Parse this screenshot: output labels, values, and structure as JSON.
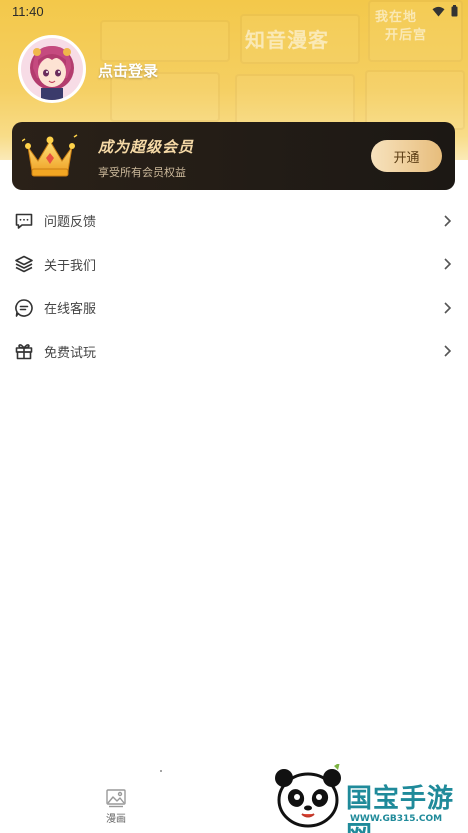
{
  "status_bar": {
    "time": "11:40",
    "wifi_icon": "wifi-icon",
    "battery_icon": "battery-icon"
  },
  "header": {
    "background_texts": [
      "知音漫客",
      "我在地",
      "开后宫"
    ],
    "login_label": "点击登录",
    "colors": {
      "header_yellow": "#f3c84a"
    }
  },
  "vip_banner": {
    "title": "成为超级会员",
    "subtitle": "享受所有会员权益",
    "button_label": "开通",
    "icon": "crown-icon",
    "colors": {
      "background": "#1f1a15",
      "title": "#f5d9a6",
      "button_gradient_start": "#f7e2bd",
      "button_gradient_end": "#e7bd7c"
    }
  },
  "menu": {
    "items": [
      {
        "label": "问题反馈",
        "icon": "feedback-icon"
      },
      {
        "label": "关于我们",
        "icon": "layers-icon"
      },
      {
        "label": "在线客服",
        "icon": "chat-icon"
      },
      {
        "label": "免费试玩",
        "icon": "gift-icon"
      }
    ]
  },
  "bottom_nav": {
    "items": [
      {
        "label": "漫画",
        "icon": "comic-image-icon"
      }
    ]
  },
  "watermark": {
    "brand": "国宝手游网",
    "url": "WWW.GB315.COM",
    "icon": "panda-logo-icon"
  }
}
